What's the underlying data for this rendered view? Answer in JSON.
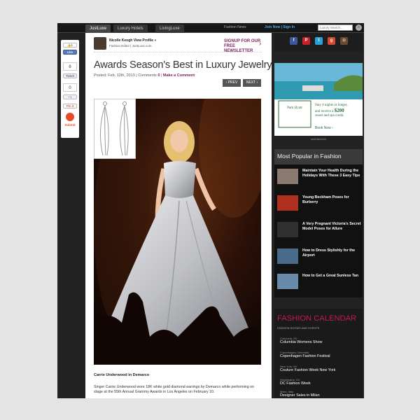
{
  "nav": {
    "tabs": [
      "JustLuxe",
      "Luxury Hotels",
      "LivingLuxe"
    ],
    "fashion_news": "Fashion News",
    "join": "Join Now | Sign In",
    "search_placeholder": "Luxury Search..."
  },
  "social": {
    "like_label": "1",
    "like_button": "Like",
    "count_a": "6",
    "tweet_label": "Tweet",
    "count_b": "0",
    "gplus_label": "+1",
    "pin_label": "Pin it",
    "submit_label": "Submit"
  },
  "editor": {
    "name": "Nicolle Keogh View Profile »",
    "sub": "Fashion Editor | JustLuxe.com",
    "signup_line1": "SIGNUP FOR OUR",
    "signup_line2": "FREE NEWSLETTER"
  },
  "article": {
    "title": "Awards Season's Best in Luxury Jewelry",
    "posted": "Posted: Feb. 12th, 2013 | Comments",
    "comments_count": "0",
    "comment_link": "Make a Comment",
    "prev": "‹ PREV",
    "next": "NEXT ›",
    "caption_title": "Carrie Underwood in Demarco",
    "caption_text": "Singer Carrie Underwood wore 18K white gold diamond earrings by Demarco while performing on stage at the 55th Annual Grammy Awards in Los Angeles on February 10."
  },
  "sidebar": {
    "ad": {
      "brand": "Park Hyatt",
      "promo_line1": "Stay 4 nights or longer,",
      "promo_line2": "and receive a",
      "promo_amount": "$200",
      "promo_line3": "resort and spa credit.",
      "cta": "Book Now",
      "label": "advertisement"
    },
    "popular": {
      "title": "Most Popular in Fashion",
      "items": [
        {
          "text": "Maintain Your Health During the Holidays With These 3 Easy Tips",
          "color": "#8a7a70"
        },
        {
          "text": "Young Beckham Poses for Burberry",
          "color": "#b03020"
        },
        {
          "text": "A Very Pregnant Victoria's Secret Model Poses for Allure",
          "color": "#303030"
        },
        {
          "text": "How to Dress Stylishly for the Airport",
          "color": "#4a6a8a"
        },
        {
          "text": "How to Get a Great Sunless Tan",
          "color": "#6a8aaa"
        }
      ]
    },
    "calendar": {
      "title": "FASHION CALENDAR",
      "sub": "FASHION SHOWS AND EVENTS",
      "items": [
        {
          "loc": "Columbia, SC",
          "name": "Columbia Womens Show"
        },
        {
          "loc": "Copenhagen, Denmark",
          "name": "Copenhagen Fashion Festival"
        },
        {
          "loc": "New York, NY",
          "name": "Couture Fashion Week New York"
        },
        {
          "loc": "Washington, DC",
          "name": "DC Fashion Week"
        },
        {
          "loc": "Milan, Italy",
          "name": "Designer Sales in Milan"
        }
      ]
    }
  }
}
